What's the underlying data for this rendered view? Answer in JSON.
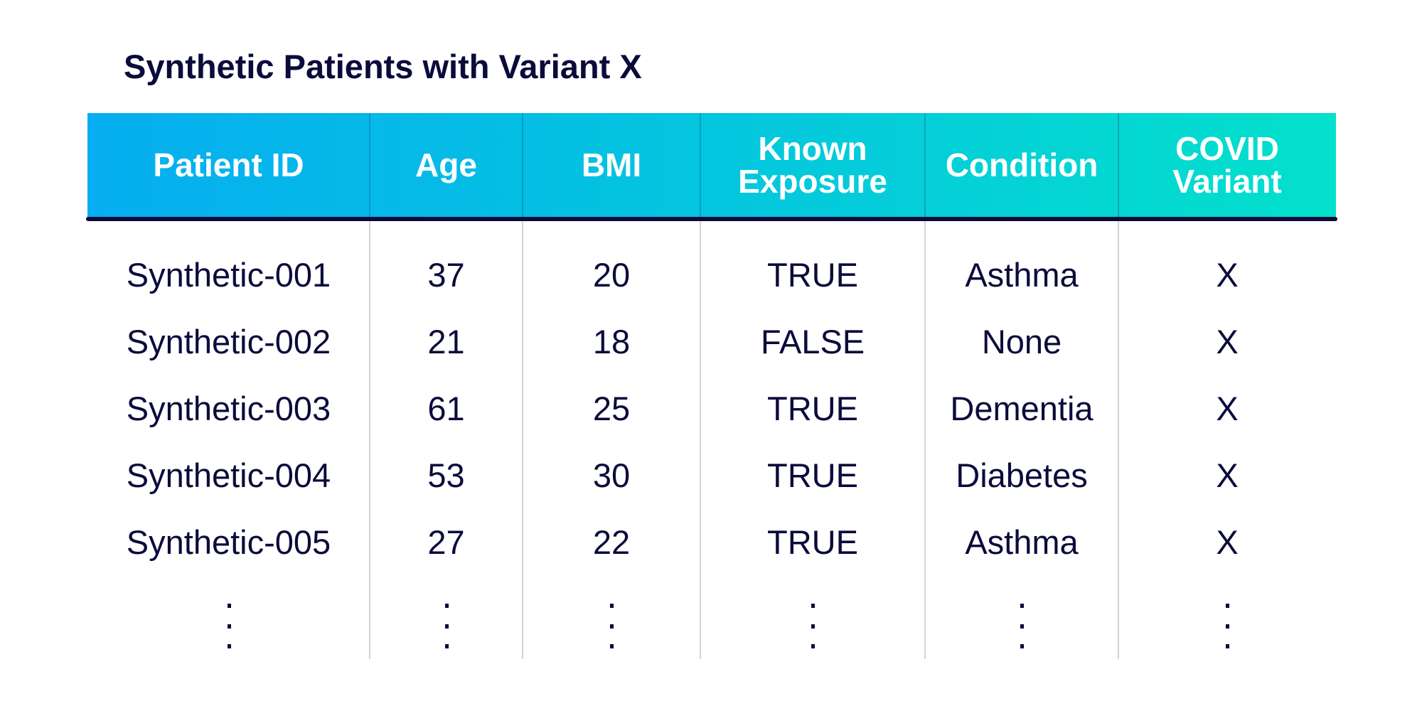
{
  "title": "Synthetic Patients with Variant X",
  "table": {
    "columns": [
      {
        "key": "patient_id",
        "label_lines": [
          "Patient ID"
        ]
      },
      {
        "key": "age",
        "label_lines": [
          "Age"
        ]
      },
      {
        "key": "bmi",
        "label_lines": [
          "BMI"
        ]
      },
      {
        "key": "known_exposure",
        "label_lines": [
          "Known",
          "Exposure"
        ]
      },
      {
        "key": "condition",
        "label_lines": [
          "Condition"
        ]
      },
      {
        "key": "covid_variant",
        "label_lines": [
          "COVID",
          "Variant"
        ]
      }
    ],
    "rows": [
      [
        "Synthetic-001",
        "37",
        "20",
        "TRUE",
        "Asthma",
        "X"
      ],
      [
        "Synthetic-002",
        "21",
        "18",
        "FALSE",
        "None",
        "X"
      ],
      [
        "Synthetic-003",
        "61",
        "25",
        "TRUE",
        "Dementia",
        "X"
      ],
      [
        "Synthetic-004",
        "53",
        "30",
        "TRUE",
        "Diabetes",
        "X"
      ],
      [
        "Synthetic-005",
        "27",
        "22",
        "TRUE",
        "Asthma",
        "X"
      ]
    ],
    "continuation": "vertical-ellipsis"
  },
  "colors": {
    "header_gradient_start": "#06aef0",
    "header_gradient_end": "#04e0cc",
    "text": "#0b0b3b",
    "header_text": "#ffffff",
    "divider": "#d2d4dd"
  }
}
